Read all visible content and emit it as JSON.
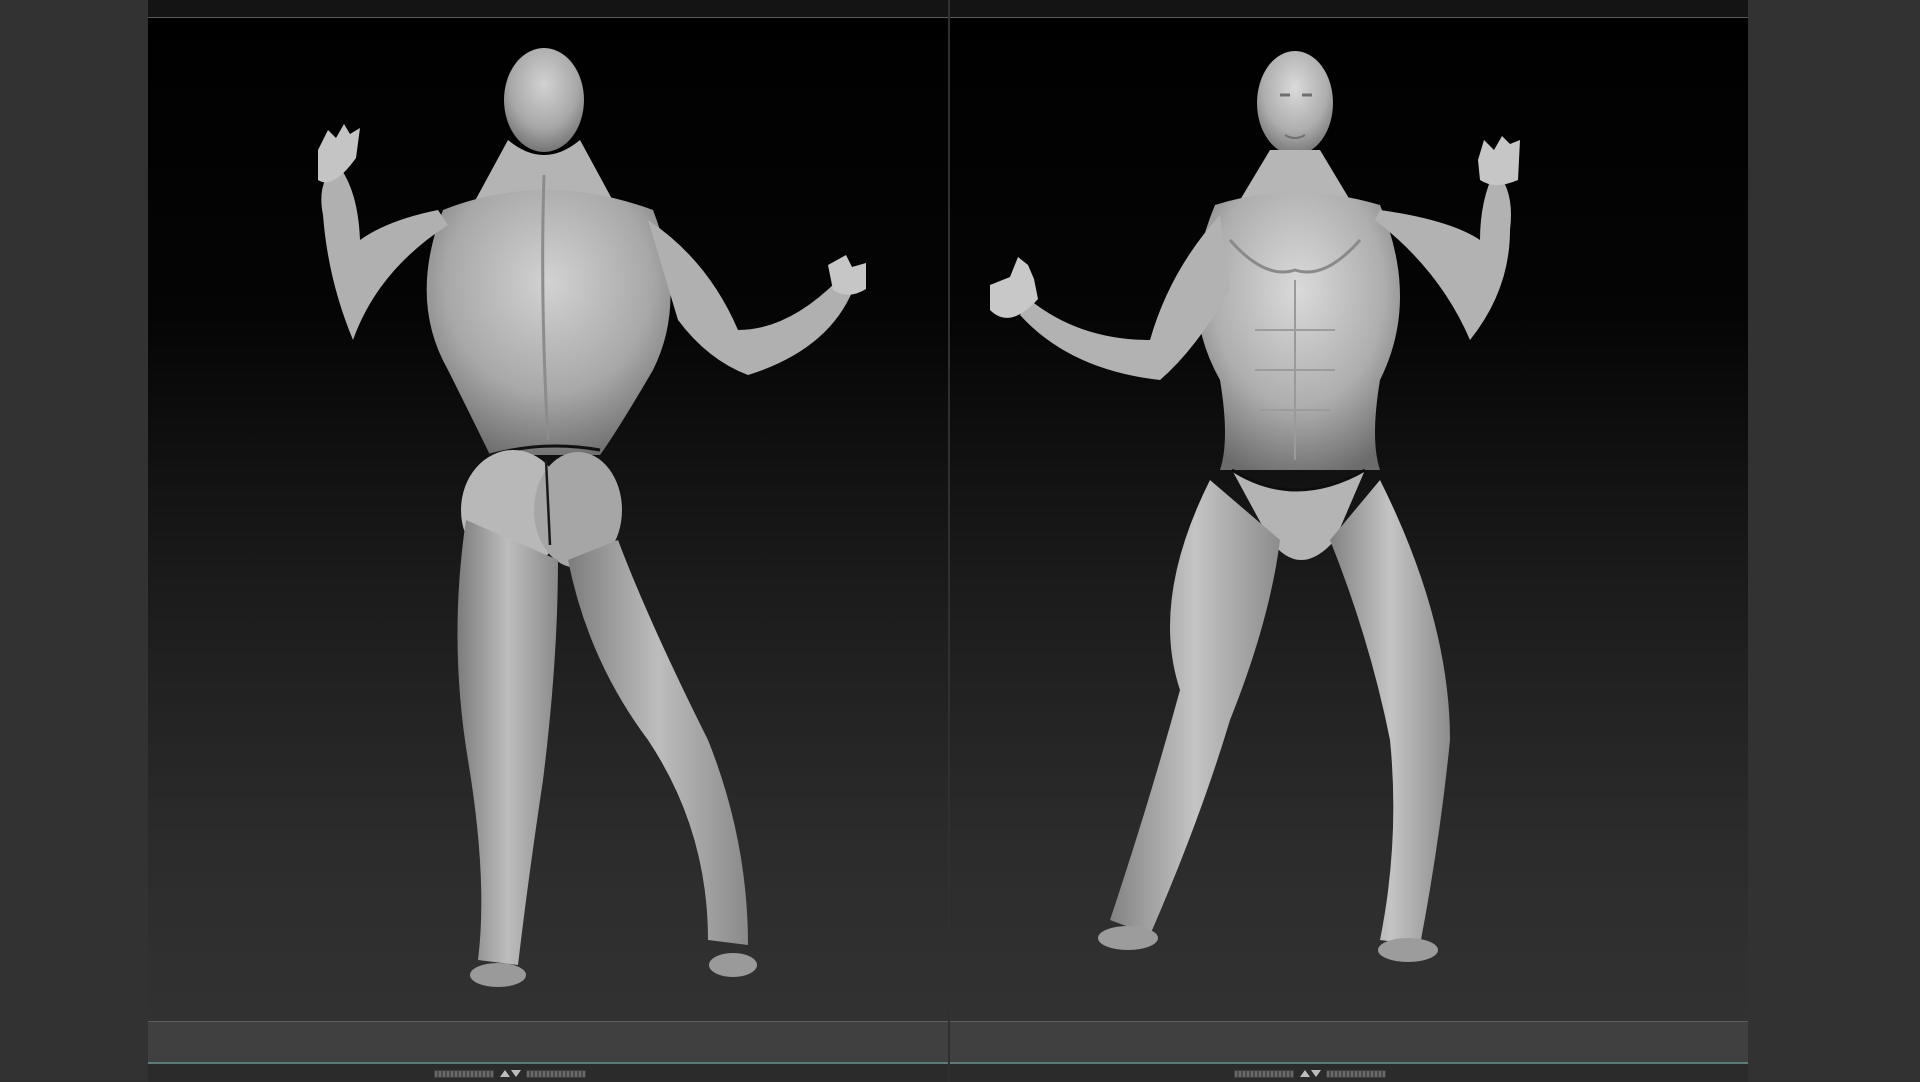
{
  "app": {
    "background": "#303030",
    "accent": "#5a7d7a"
  },
  "viewports": [
    {
      "view": "back",
      "subject": "male-anatomy-sculpt",
      "material": "grey-matcap"
    },
    {
      "view": "front",
      "subject": "male-anatomy-sculpt",
      "material": "grey-matcap"
    }
  ],
  "icons": {
    "scroll": "up-down-arrows-icon"
  }
}
